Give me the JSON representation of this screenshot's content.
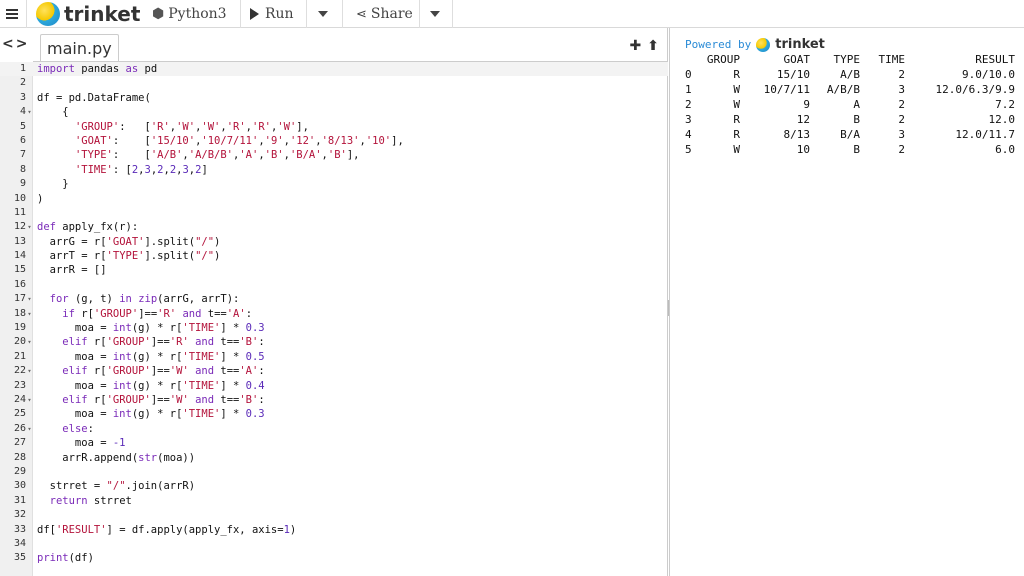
{
  "toolbar": {
    "brand": "trinket",
    "language": "Python3",
    "run_label": "Run",
    "share_label": "Share"
  },
  "editor": {
    "tab_name": "main.py",
    "lines": [
      {
        "n": "1",
        "fold": "",
        "html": "<span class=\"kw\">import</span> pandas <span class=\"kw\">as</span> pd"
      },
      {
        "n": "2",
        "fold": "",
        "html": ""
      },
      {
        "n": "3",
        "fold": "",
        "html": "df = pd.DataFrame("
      },
      {
        "n": "4",
        "fold": "▾",
        "html": "    {"
      },
      {
        "n": "5",
        "fold": "",
        "html": "      <span class=\"str\">'GROUP'</span>:   [<span class=\"str\">'R'</span>,<span class=\"str\">'W'</span>,<span class=\"str\">'W'</span>,<span class=\"str\">'R'</span>,<span class=\"str\">'R'</span>,<span class=\"str\">'W'</span>],"
      },
      {
        "n": "6",
        "fold": "",
        "html": "      <span class=\"str\">'GOAT'</span>:    [<span class=\"str\">'15/10'</span>,<span class=\"str\">'10/7/11'</span>,<span class=\"str\">'9'</span>,<span class=\"str\">'12'</span>,<span class=\"str\">'8/13'</span>,<span class=\"str\">'10'</span>],"
      },
      {
        "n": "7",
        "fold": "",
        "html": "      <span class=\"str\">'TYPE'</span>:    [<span class=\"str\">'A/B'</span>,<span class=\"str\">'A/B/B'</span>,<span class=\"str\">'A'</span>,<span class=\"str\">'B'</span>,<span class=\"str\">'B/A'</span>,<span class=\"str\">'B'</span>],"
      },
      {
        "n": "8",
        "fold": "",
        "html": "      <span class=\"str\">'TIME'</span>: [<span class=\"num\">2</span>,<span class=\"num\">3</span>,<span class=\"num\">2</span>,<span class=\"num\">2</span>,<span class=\"num\">3</span>,<span class=\"num\">2</span>]"
      },
      {
        "n": "9",
        "fold": "",
        "html": "    }"
      },
      {
        "n": "10",
        "fold": "",
        "html": ")"
      },
      {
        "n": "11",
        "fold": "",
        "html": ""
      },
      {
        "n": "12",
        "fold": "▾",
        "html": "<span class=\"kw\">def</span> apply_fx(r):"
      },
      {
        "n": "13",
        "fold": "",
        "html": "  arrG = r[<span class=\"str\">'GOAT'</span>].split(<span class=\"str\">\"/\"</span>)"
      },
      {
        "n": "14",
        "fold": "",
        "html": "  arrT = r[<span class=\"str\">'TYPE'</span>].split(<span class=\"str\">\"/\"</span>)"
      },
      {
        "n": "15",
        "fold": "",
        "html": "  arrR = []"
      },
      {
        "n": "16",
        "fold": "",
        "html": ""
      },
      {
        "n": "17",
        "fold": "▾",
        "html": "  <span class=\"kw\">for</span> (g, t) <span class=\"kw\">in</span> <span class=\"kw\">zip</span>(arrG, arrT):"
      },
      {
        "n": "18",
        "fold": "▾",
        "html": "    <span class=\"kw\">if</span> r[<span class=\"str\">'GROUP'</span>]==<span class=\"str\">'R'</span> <span class=\"kw\">and</span> t==<span class=\"str\">'A'</span>:"
      },
      {
        "n": "19",
        "fold": "",
        "html": "      moa = <span class=\"kw\">int</span>(g) * r[<span class=\"str\">'TIME'</span>] * <span class=\"num\">0.3</span>"
      },
      {
        "n": "20",
        "fold": "▾",
        "html": "    <span class=\"kw\">elif</span> r[<span class=\"str\">'GROUP'</span>]==<span class=\"str\">'R'</span> <span class=\"kw\">and</span> t==<span class=\"str\">'B'</span>:"
      },
      {
        "n": "21",
        "fold": "",
        "html": "      moa = <span class=\"kw\">int</span>(g) * r[<span class=\"str\">'TIME'</span>] * <span class=\"num\">0.5</span>"
      },
      {
        "n": "22",
        "fold": "▾",
        "html": "    <span class=\"kw\">elif</span> r[<span class=\"str\">'GROUP'</span>]==<span class=\"str\">'W'</span> <span class=\"kw\">and</span> t==<span class=\"str\">'A'</span>:"
      },
      {
        "n": "23",
        "fold": "",
        "html": "      moa = <span class=\"kw\">int</span>(g) * r[<span class=\"str\">'TIME'</span>] * <span class=\"num\">0.4</span>"
      },
      {
        "n": "24",
        "fold": "▾",
        "html": "    <span class=\"kw\">elif</span> r[<span class=\"str\">'GROUP'</span>]==<span class=\"str\">'W'</span> <span class=\"kw\">and</span> t==<span class=\"str\">'B'</span>:"
      },
      {
        "n": "25",
        "fold": "",
        "html": "      moa = <span class=\"kw\">int</span>(g) * r[<span class=\"str\">'TIME'</span>] * <span class=\"num\">0.3</span>"
      },
      {
        "n": "26",
        "fold": "▾",
        "html": "    <span class=\"kw\">else</span>:"
      },
      {
        "n": "27",
        "fold": "",
        "html": "      moa = <span class=\"num\">-1</span>"
      },
      {
        "n": "28",
        "fold": "",
        "html": "    arrR.append(<span class=\"kw\">str</span>(moa))"
      },
      {
        "n": "29",
        "fold": "",
        "html": ""
      },
      {
        "n": "30",
        "fold": "",
        "html": "  strret = <span class=\"str\">\"/\"</span>.join(arrR)"
      },
      {
        "n": "31",
        "fold": "",
        "html": "  <span class=\"kw\">return</span> strret"
      },
      {
        "n": "32",
        "fold": "",
        "html": ""
      },
      {
        "n": "33",
        "fold": "",
        "html": "df[<span class=\"str\">'RESULT'</span>] = df.apply(apply_fx, axis=<span class=\"num\">1</span>)"
      },
      {
        "n": "34",
        "fold": "",
        "html": ""
      },
      {
        "n": "35",
        "fold": "",
        "html": "<span class=\"kw\">print</span>(df)"
      }
    ]
  },
  "output": {
    "powered_by": "Powered by",
    "brand": "trinket",
    "headers": {
      "group": "GROUP",
      "goat": "GOAT",
      "type": "TYPE",
      "time": "TIME",
      "result": "RESULT"
    },
    "rows": [
      {
        "idx": "0",
        "group": "R",
        "goat": "15/10",
        "type": "A/B",
        "time": "2",
        "result": "9.0/10.0"
      },
      {
        "idx": "1",
        "group": "W",
        "goat": "10/7/11",
        "type": "A/B/B",
        "time": "3",
        "result": "12.0/6.3/9.9"
      },
      {
        "idx": "2",
        "group": "W",
        "goat": "9",
        "type": "A",
        "time": "2",
        "result": "7.2"
      },
      {
        "idx": "3",
        "group": "R",
        "goat": "12",
        "type": "B",
        "time": "2",
        "result": "12.0"
      },
      {
        "idx": "4",
        "group": "R",
        "goat": "8/13",
        "type": "B/A",
        "time": "3",
        "result": "12.0/11.7"
      },
      {
        "idx": "5",
        "group": "W",
        "goat": "10",
        "type": "B",
        "time": "2",
        "result": "6.0"
      }
    ]
  }
}
